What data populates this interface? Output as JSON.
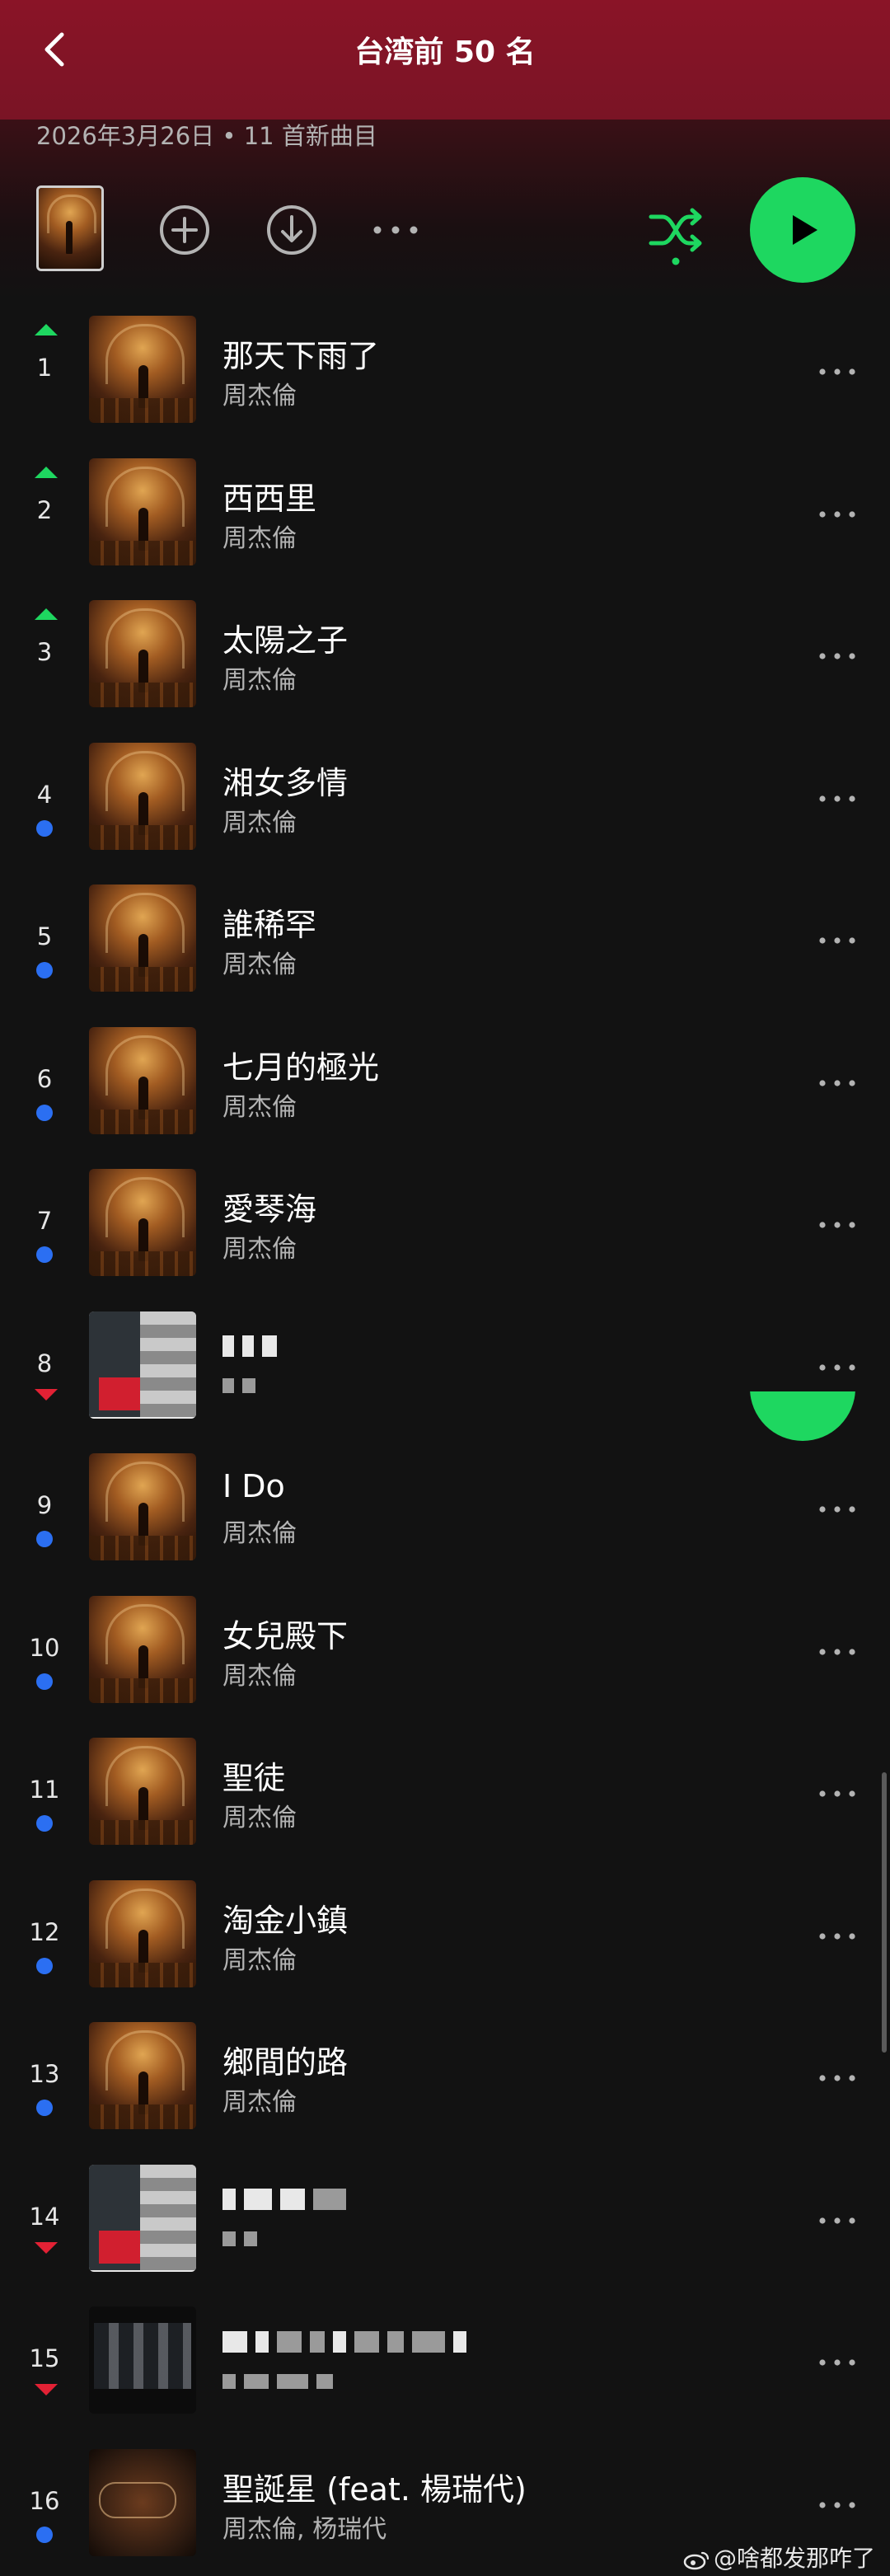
{
  "header": {
    "title": "台湾前 50 名"
  },
  "meta": {
    "text": "2026年3月26日 • 11 首新曲目"
  },
  "colors": {
    "accent": "#1ed760",
    "up": "#1ed760",
    "down": "#e22134",
    "new": "#2b6ff2"
  },
  "icons": {
    "back": "chevron-left-icon",
    "add": "plus-circle-icon",
    "download": "download-circle-icon",
    "more": "more-horizontal-icon",
    "shuffle": "shuffle-icon",
    "play": "play-icon"
  },
  "tracks": [
    {
      "rank": "1",
      "trend": "up",
      "title": "那天下雨了",
      "artist": "周杰倫"
    },
    {
      "rank": "2",
      "trend": "up",
      "title": "西西里",
      "artist": "周杰倫"
    },
    {
      "rank": "3",
      "trend": "up",
      "title": "太陽之子",
      "artist": "周杰倫"
    },
    {
      "rank": "4",
      "trend": "new",
      "title": "湘女多情",
      "artist": "周杰倫"
    },
    {
      "rank": "5",
      "trend": "new",
      "title": "誰稀罕",
      "artist": "周杰倫"
    },
    {
      "rank": "6",
      "trend": "new",
      "title": "七月的極光",
      "artist": "周杰倫"
    },
    {
      "rank": "7",
      "trend": "new",
      "title": "愛琴海",
      "artist": "周杰倫"
    },
    {
      "rank": "8",
      "trend": "down",
      "title": "",
      "artist": ""
    },
    {
      "rank": "9",
      "trend": "new",
      "title": "I Do",
      "artist": "周杰倫"
    },
    {
      "rank": "10",
      "trend": "new",
      "title": "女兒殿下",
      "artist": "周杰倫"
    },
    {
      "rank": "11",
      "trend": "new",
      "title": "聖徒",
      "artist": "周杰倫"
    },
    {
      "rank": "12",
      "trend": "new",
      "title": "淘金小鎮",
      "artist": "周杰倫"
    },
    {
      "rank": "13",
      "trend": "new",
      "title": "鄉間的路",
      "artist": "周杰倫"
    },
    {
      "rank": "14",
      "trend": "down",
      "title": "",
      "artist": ""
    },
    {
      "rank": "15",
      "trend": "down",
      "title": "",
      "artist": ""
    },
    {
      "rank": "16",
      "trend": "new",
      "title": "聖誕星 (feat. 楊瑞代)",
      "artist": "周杰倫, 杨瑞代"
    }
  ],
  "watermark": {
    "text": "@啥都发那咋了"
  }
}
